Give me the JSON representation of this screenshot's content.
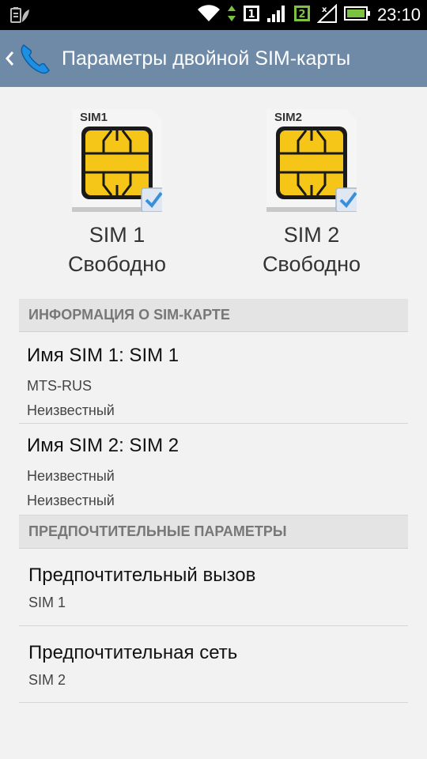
{
  "status_bar": {
    "time": "23:10",
    "sim1_indicator": "1",
    "sim2_indicator": "2",
    "icons": [
      "battery-saver-icon",
      "wifi-icon",
      "data-arrows-icon",
      "sim1-signal-icon",
      "sim2-no-signal-icon",
      "battery-icon"
    ]
  },
  "action_bar": {
    "title": "Параметры двойной SIM-карты",
    "icons": [
      "back-chevron-icon",
      "phone-app-icon"
    ]
  },
  "sims": [
    {
      "chip_label": "SIM1",
      "name": "SIM 1",
      "status": "Свободно"
    },
    {
      "chip_label": "SIM2",
      "name": "SIM 2",
      "status": "Свободно"
    }
  ],
  "sections": {
    "sim_info": "ИНФОРМАЦИЯ О SIM-КАРТЕ",
    "preferences": "ПРЕДПОЧТИТЕЛЬНЫЕ ПАРАМЕТРЫ"
  },
  "sim_info_items": [
    {
      "title": "Имя SIM 1: SIM 1",
      "line1": "MTS-RUS",
      "line2": "Неизвестный"
    },
    {
      "title": "Имя SIM 2: SIM 2",
      "line1": "Неизвестный",
      "line2": "Неизвестный"
    }
  ],
  "pref_items": [
    {
      "title": "Предпочтительный вызов",
      "value": "SIM 1"
    },
    {
      "title": "Предпочтительная сеть",
      "value": "SIM 2"
    }
  ],
  "colors": {
    "action_bar": "#6e8aa7",
    "chip_gold": "#f5c518",
    "check_blue": "#3b8fd9",
    "sim2_badge": "#7cc242",
    "battery": "#7cc242"
  }
}
